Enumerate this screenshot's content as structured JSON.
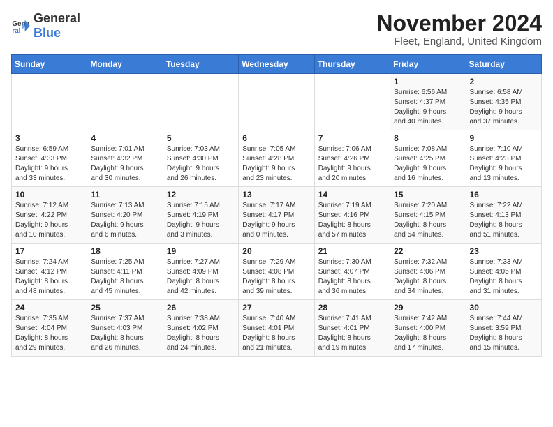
{
  "logo": {
    "text_general": "General",
    "text_blue": "Blue",
    "icon_symbol": "▶"
  },
  "title": "November 2024",
  "subtitle": "Fleet, England, United Kingdom",
  "weekdays": [
    "Sunday",
    "Monday",
    "Tuesday",
    "Wednesday",
    "Thursday",
    "Friday",
    "Saturday"
  ],
  "weeks": [
    [
      {
        "day": "",
        "info": ""
      },
      {
        "day": "",
        "info": ""
      },
      {
        "day": "",
        "info": ""
      },
      {
        "day": "",
        "info": ""
      },
      {
        "day": "",
        "info": ""
      },
      {
        "day": "1",
        "info": "Sunrise: 6:56 AM\nSunset: 4:37 PM\nDaylight: 9 hours\nand 40 minutes."
      },
      {
        "day": "2",
        "info": "Sunrise: 6:58 AM\nSunset: 4:35 PM\nDaylight: 9 hours\nand 37 minutes."
      }
    ],
    [
      {
        "day": "3",
        "info": "Sunrise: 6:59 AM\nSunset: 4:33 PM\nDaylight: 9 hours\nand 33 minutes."
      },
      {
        "day": "4",
        "info": "Sunrise: 7:01 AM\nSunset: 4:32 PM\nDaylight: 9 hours\nand 30 minutes."
      },
      {
        "day": "5",
        "info": "Sunrise: 7:03 AM\nSunset: 4:30 PM\nDaylight: 9 hours\nand 26 minutes."
      },
      {
        "day": "6",
        "info": "Sunrise: 7:05 AM\nSunset: 4:28 PM\nDaylight: 9 hours\nand 23 minutes."
      },
      {
        "day": "7",
        "info": "Sunrise: 7:06 AM\nSunset: 4:26 PM\nDaylight: 9 hours\nand 20 minutes."
      },
      {
        "day": "8",
        "info": "Sunrise: 7:08 AM\nSunset: 4:25 PM\nDaylight: 9 hours\nand 16 minutes."
      },
      {
        "day": "9",
        "info": "Sunrise: 7:10 AM\nSunset: 4:23 PM\nDaylight: 9 hours\nand 13 minutes."
      }
    ],
    [
      {
        "day": "10",
        "info": "Sunrise: 7:12 AM\nSunset: 4:22 PM\nDaylight: 9 hours\nand 10 minutes."
      },
      {
        "day": "11",
        "info": "Sunrise: 7:13 AM\nSunset: 4:20 PM\nDaylight: 9 hours\nand 6 minutes."
      },
      {
        "day": "12",
        "info": "Sunrise: 7:15 AM\nSunset: 4:19 PM\nDaylight: 9 hours\nand 3 minutes."
      },
      {
        "day": "13",
        "info": "Sunrise: 7:17 AM\nSunset: 4:17 PM\nDaylight: 9 hours\nand 0 minutes."
      },
      {
        "day": "14",
        "info": "Sunrise: 7:19 AM\nSunset: 4:16 PM\nDaylight: 8 hours\nand 57 minutes."
      },
      {
        "day": "15",
        "info": "Sunrise: 7:20 AM\nSunset: 4:15 PM\nDaylight: 8 hours\nand 54 minutes."
      },
      {
        "day": "16",
        "info": "Sunrise: 7:22 AM\nSunset: 4:13 PM\nDaylight: 8 hours\nand 51 minutes."
      }
    ],
    [
      {
        "day": "17",
        "info": "Sunrise: 7:24 AM\nSunset: 4:12 PM\nDaylight: 8 hours\nand 48 minutes."
      },
      {
        "day": "18",
        "info": "Sunrise: 7:25 AM\nSunset: 4:11 PM\nDaylight: 8 hours\nand 45 minutes."
      },
      {
        "day": "19",
        "info": "Sunrise: 7:27 AM\nSunset: 4:09 PM\nDaylight: 8 hours\nand 42 minutes."
      },
      {
        "day": "20",
        "info": "Sunrise: 7:29 AM\nSunset: 4:08 PM\nDaylight: 8 hours\nand 39 minutes."
      },
      {
        "day": "21",
        "info": "Sunrise: 7:30 AM\nSunset: 4:07 PM\nDaylight: 8 hours\nand 36 minutes."
      },
      {
        "day": "22",
        "info": "Sunrise: 7:32 AM\nSunset: 4:06 PM\nDaylight: 8 hours\nand 34 minutes."
      },
      {
        "day": "23",
        "info": "Sunrise: 7:33 AM\nSunset: 4:05 PM\nDaylight: 8 hours\nand 31 minutes."
      }
    ],
    [
      {
        "day": "24",
        "info": "Sunrise: 7:35 AM\nSunset: 4:04 PM\nDaylight: 8 hours\nand 29 minutes."
      },
      {
        "day": "25",
        "info": "Sunrise: 7:37 AM\nSunset: 4:03 PM\nDaylight: 8 hours\nand 26 minutes."
      },
      {
        "day": "26",
        "info": "Sunrise: 7:38 AM\nSunset: 4:02 PM\nDaylight: 8 hours\nand 24 minutes."
      },
      {
        "day": "27",
        "info": "Sunrise: 7:40 AM\nSunset: 4:01 PM\nDaylight: 8 hours\nand 21 minutes."
      },
      {
        "day": "28",
        "info": "Sunrise: 7:41 AM\nSunset: 4:01 PM\nDaylight: 8 hours\nand 19 minutes."
      },
      {
        "day": "29",
        "info": "Sunrise: 7:42 AM\nSunset: 4:00 PM\nDaylight: 8 hours\nand 17 minutes."
      },
      {
        "day": "30",
        "info": "Sunrise: 7:44 AM\nSunset: 3:59 PM\nDaylight: 8 hours\nand 15 minutes."
      }
    ]
  ]
}
